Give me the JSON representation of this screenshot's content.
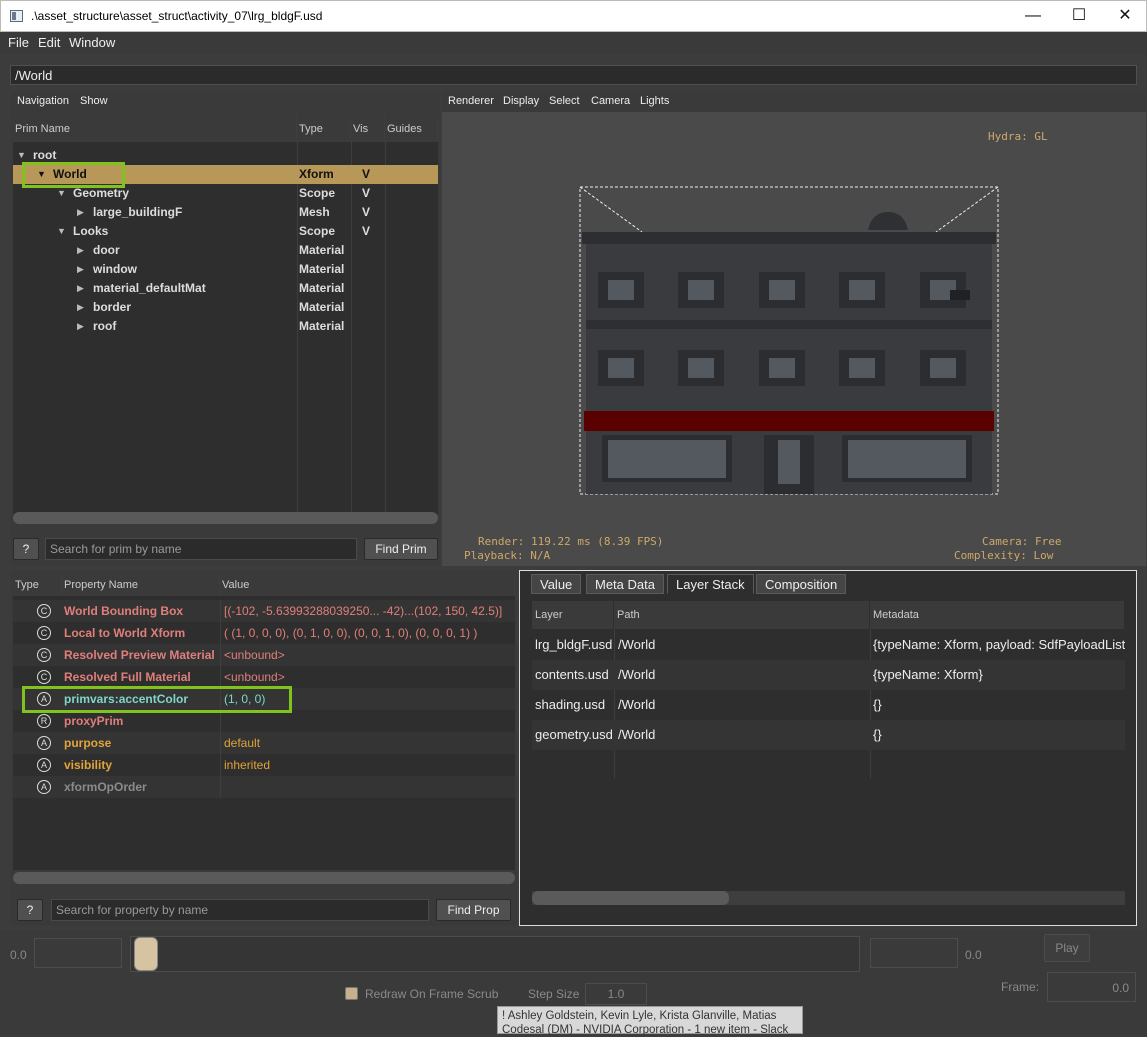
{
  "window": {
    "title": ".\\asset_structure\\asset_struct\\activity_07\\lrg_bldgF.usd",
    "min_glyph": "—",
    "max_glyph": "☐",
    "close_glyph": "✕"
  },
  "menubar": [
    "File",
    "Edit",
    "Window"
  ],
  "path": "/World",
  "navigation": {
    "menus": [
      "Navigation",
      "Show"
    ],
    "columns": [
      "Prim Name",
      "Type",
      "Vis",
      "Guides"
    ],
    "rows": [
      {
        "name": "root",
        "type": "",
        "vis": "",
        "level": 0,
        "expander": "▼"
      },
      {
        "name": "World",
        "type": "Xform",
        "vis": "V",
        "level": 1,
        "expander": "▼",
        "selected": true
      },
      {
        "name": "Geometry",
        "type": "Scope",
        "vis": "V",
        "level": 2,
        "expander": "▼"
      },
      {
        "name": "large_buildingF",
        "type": "Mesh",
        "vis": "V",
        "level": 3,
        "expander": "▶"
      },
      {
        "name": "Looks",
        "type": "Scope",
        "vis": "V",
        "level": 2,
        "expander": "▼"
      },
      {
        "name": "door",
        "type": "Material",
        "vis": "",
        "level": 3,
        "expander": "▶"
      },
      {
        "name": "window",
        "type": "Material",
        "vis": "",
        "level": 3,
        "expander": "▶"
      },
      {
        "name": "material_defaultMat",
        "type": "Material",
        "vis": "",
        "level": 3,
        "expander": "▶"
      },
      {
        "name": "border",
        "type": "Material",
        "vis": "",
        "level": 3,
        "expander": "▶"
      },
      {
        "name": "roof",
        "type": "Material",
        "vis": "",
        "level": 3,
        "expander": "▶"
      }
    ],
    "help_label": "?",
    "search_placeholder": "Search for prim by name",
    "find_label": "Find Prim"
  },
  "viewport": {
    "menus": [
      "Renderer",
      "Display",
      "Select",
      "Camera",
      "Lights"
    ],
    "hydra": "Hydra: GL",
    "render": "Render: 119.22 ms (8.39 FPS)",
    "playback": "Playback: N/A",
    "camera": "Camera: Free",
    "complexity": "Complexity: Low"
  },
  "properties": {
    "columns": [
      "Type",
      "Property Name",
      "Value"
    ],
    "rows": [
      {
        "type": "C",
        "name": "World Bounding Box",
        "value": "[(-102, -5.63993288039250... -42)...(102, 150, 42.5)]",
        "name_color": "#e07f7a",
        "value_color": "#e07f7a"
      },
      {
        "type": "C",
        "name": "Local to World Xform",
        "value": "( (1, 0, 0, 0), (0, 1, 0, 0), (0, 0, 1, 0), (0, 0, 0, 1) )",
        "name_color": "#e07f7a",
        "value_color": "#e07f7a"
      },
      {
        "type": "C",
        "name": "Resolved Preview Material",
        "value": "<unbound>",
        "name_color": "#e07f7a",
        "value_color": "#e07f7a"
      },
      {
        "type": "C",
        "name": "Resolved Full Material",
        "value": "<unbound>",
        "name_color": "#e07f7a",
        "value_color": "#e07f7a"
      },
      {
        "type": "A",
        "name": "primvars:accentColor",
        "value": "(1, 0, 0)",
        "name_color": "#7fd6c8",
        "value_color": "#7fd6c8"
      },
      {
        "type": "R",
        "name": "proxyPrim",
        "value": "",
        "name_color": "#e07f7a",
        "value_color": "#e07f7a"
      },
      {
        "type": "A",
        "name": "purpose",
        "value": "default",
        "name_color": "#e0a43a",
        "value_color": "#e0a43a"
      },
      {
        "type": "A",
        "name": "visibility",
        "value": "inherited",
        "name_color": "#e0a43a",
        "value_color": "#e0a43a"
      },
      {
        "type": "A",
        "name": "xformOpOrder",
        "value": "",
        "name_color": "#8c8c8c",
        "value_color": "#8c8c8c"
      }
    ],
    "help_label": "?",
    "search_placeholder": "Search for property by name",
    "find_label": "Find Prop"
  },
  "inspector": {
    "tabs": [
      "Value",
      "Meta Data",
      "Layer Stack",
      "Composition"
    ],
    "active_tab": "Layer Stack",
    "columns": [
      "Layer",
      "Path",
      "Metadata"
    ],
    "rows": [
      {
        "layer": "lrg_bldgF.usd",
        "path": "/World",
        "metadata": "{typeName: Xform, payload: SdfPayloadListOp(...)}"
      },
      {
        "layer": "contents.usd",
        "path": "/World",
        "metadata": "{typeName: Xform}"
      },
      {
        "layer": "shading.usd",
        "path": "/World",
        "metadata": "{}"
      },
      {
        "layer": "geometry.usd",
        "path": "/World",
        "metadata": "{}"
      }
    ]
  },
  "timeline": {
    "start_value": "0.0",
    "end_value": "0.0",
    "play_label": "Play",
    "redraw_label": "Redraw On Frame Scrub",
    "step_label": "Step Size",
    "step_value": "1.0",
    "frame_label": "Frame:",
    "frame_value": "0.0"
  },
  "toast": {
    "line1": "! Ashley Goldstein, Kevin Lyle, Krista Glanville, Matias",
    "line2": "Codesal (DM) - NVIDIA Corporation - 1 new item - Slack"
  },
  "colors": {
    "selection": "#b79859",
    "highlight_box": "#7fc31c",
    "hud": "#cda969",
    "awning": "#5a0000"
  }
}
